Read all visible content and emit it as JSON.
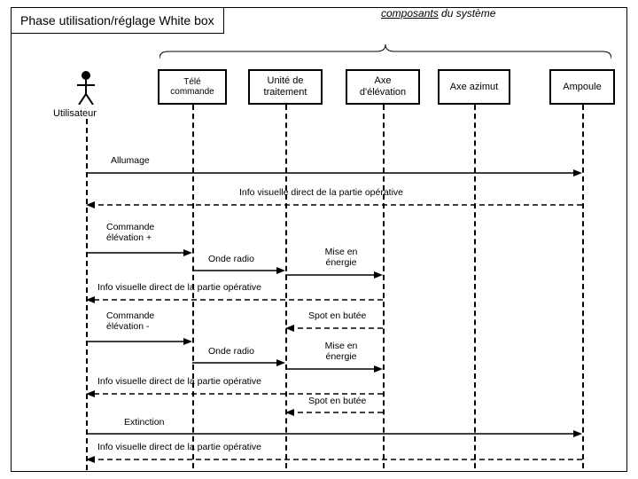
{
  "title": "Phase utilisation/réglage White box",
  "header": {
    "word1": "composants",
    "rest": " du système"
  },
  "actor": {
    "label": "Utilisateur"
  },
  "participants": {
    "p1": "Télé commande",
    "p2": "Unité de traitement",
    "p3": "Axe d'élévation",
    "p4": "Axe azimut",
    "p5": "Ampoule"
  },
  "messages": {
    "m1": "Allumage",
    "m2": "Info visuelle direct de la partie opérative",
    "m3": "Commande élévation +",
    "m4": "Onde radio",
    "m5": "Mise en énergie",
    "m6": "Info visuelle direct de la partie opérative",
    "m7": "Commande élévation -",
    "m8": "Spot en butée",
    "m9": "Onde radio",
    "m10": "Mise en énergie",
    "m11": "Info visuelle direct de la partie opérative",
    "m12": "Spot en butée",
    "m13": "Extinction",
    "m14": "Info visuelle direct de la partie opérative"
  },
  "chart_data": {
    "type": "sequence-diagram",
    "actor": "Utilisateur",
    "participants": [
      "Télé commande",
      "Unité de traitement",
      "Axe d'élévation",
      "Axe azimut",
      "Ampoule"
    ],
    "group_label": "composants du système",
    "messages": [
      {
        "from": "Utilisateur",
        "to": "Ampoule",
        "label": "Allumage"
      },
      {
        "from": "Ampoule",
        "to": "Utilisateur",
        "label": "Info visuelle direct de la partie opérative",
        "return": true
      },
      {
        "from": "Utilisateur",
        "to": "Télé commande",
        "label": "Commande élévation +"
      },
      {
        "from": "Télé commande",
        "to": "Unité de traitement",
        "label": "Onde radio"
      },
      {
        "from": "Unité de traitement",
        "to": "Axe d'élévation",
        "label": "Mise en énergie"
      },
      {
        "from": "Axe d'élévation",
        "to": "Utilisateur",
        "label": "Info visuelle direct de la partie opérative",
        "return": true
      },
      {
        "from": "Utilisateur",
        "to": "Télé commande",
        "label": "Commande élévation -"
      },
      {
        "from": "Axe d'élévation",
        "to": "Unité de traitement",
        "label": "Spot en butée",
        "return": true
      },
      {
        "from": "Télé commande",
        "to": "Unité de traitement",
        "label": "Onde radio"
      },
      {
        "from": "Unité de traitement",
        "to": "Axe d'élévation",
        "label": "Mise en énergie"
      },
      {
        "from": "Axe d'élévation",
        "to": "Utilisateur",
        "label": "Info visuelle direct de la partie opérative",
        "return": true
      },
      {
        "from": "Axe d'élévation",
        "to": "Unité de traitement",
        "label": "Spot en butée",
        "return": true
      },
      {
        "from": "Utilisateur",
        "to": "Ampoule",
        "label": "Extinction"
      },
      {
        "from": "Ampoule",
        "to": "Utilisateur",
        "label": "Info visuelle direct de la partie opérative",
        "return": true
      }
    ]
  }
}
